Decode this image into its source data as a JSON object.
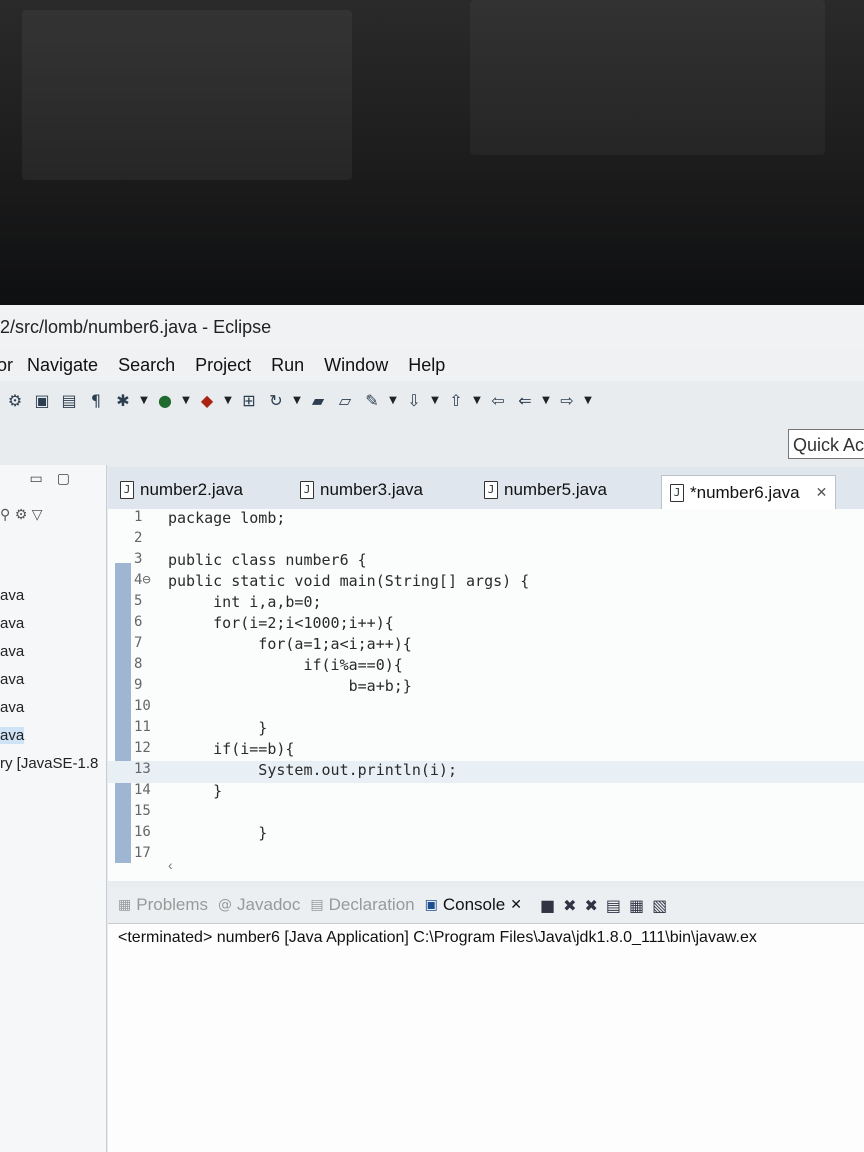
{
  "window": {
    "title": "2/src/lomb/number6.java - Eclipse"
  },
  "menu": [
    "or",
    "Navigate",
    "Search",
    "Project",
    "Run",
    "Window",
    "Help"
  ],
  "toolbar_icons": [
    "settings-icon",
    "save-icon",
    "print-icon",
    "pilcrow-icon",
    "debug-icon",
    "run-icon",
    "run-config-icon",
    "open-type-icon",
    "refresh-icon",
    "open-folder-icon",
    "new-folder-icon",
    "pin-icon",
    "next-annotation-icon",
    "prev-annotation-icon",
    "back-icon",
    "prev-edit-icon",
    "forward-icon"
  ],
  "quick_access": {
    "placeholder": "Quick Acc"
  },
  "package_explorer": {
    "items": [
      "ava",
      "ava",
      "ava",
      "ava",
      "ava",
      "ava",
      "ry [JavaSE-1.8"
    ]
  },
  "editor": {
    "tabs": [
      {
        "label": "number2.java",
        "active": false
      },
      {
        "label": "number3.java",
        "active": false
      },
      {
        "label": "number5.java",
        "active": false
      },
      {
        "label": "*number6.java",
        "active": true
      }
    ],
    "lines": [
      {
        "num": "1",
        "text": "package lomb;"
      },
      {
        "num": "2",
        "text": ""
      },
      {
        "num": "3",
        "text": "public class number6 {"
      },
      {
        "num": "4⊖",
        "text": "public static void main(String[] args) {"
      },
      {
        "num": "5",
        "text": "     int i,a,b=0;"
      },
      {
        "num": "6",
        "text": "     for(i=2;i<1000;i++){"
      },
      {
        "num": "7",
        "text": "          for(a=1;a<i;a++){"
      },
      {
        "num": "8",
        "text": "               if(i%a==0){"
      },
      {
        "num": "9",
        "text": "                    b=a+b;}"
      },
      {
        "num": "10",
        "text": ""
      },
      {
        "num": "11",
        "text": "          }"
      },
      {
        "num": "12",
        "text": "     if(i==b){"
      },
      {
        "num": "13",
        "text": "          System.out.println(i);"
      },
      {
        "num": "14",
        "text": "     }"
      },
      {
        "num": "15",
        "text": ""
      },
      {
        "num": "16",
        "text": "          }"
      },
      {
        "num": "17",
        "text": ""
      }
    ],
    "current_line": "13"
  },
  "bottom_panel": {
    "tabs": [
      {
        "label": "Problems",
        "icon": "problems-icon"
      },
      {
        "label": "Javadoc",
        "icon": "javadoc-icon"
      },
      {
        "label": "Declaration",
        "icon": "declaration-icon"
      },
      {
        "label": "Console",
        "icon": "console-icon",
        "active": true
      }
    ],
    "console_output": "<terminated> number6 [Java Application] C:\\Program Files\\Java\\jdk1.8.0_111\\bin\\javaw.ex"
  }
}
